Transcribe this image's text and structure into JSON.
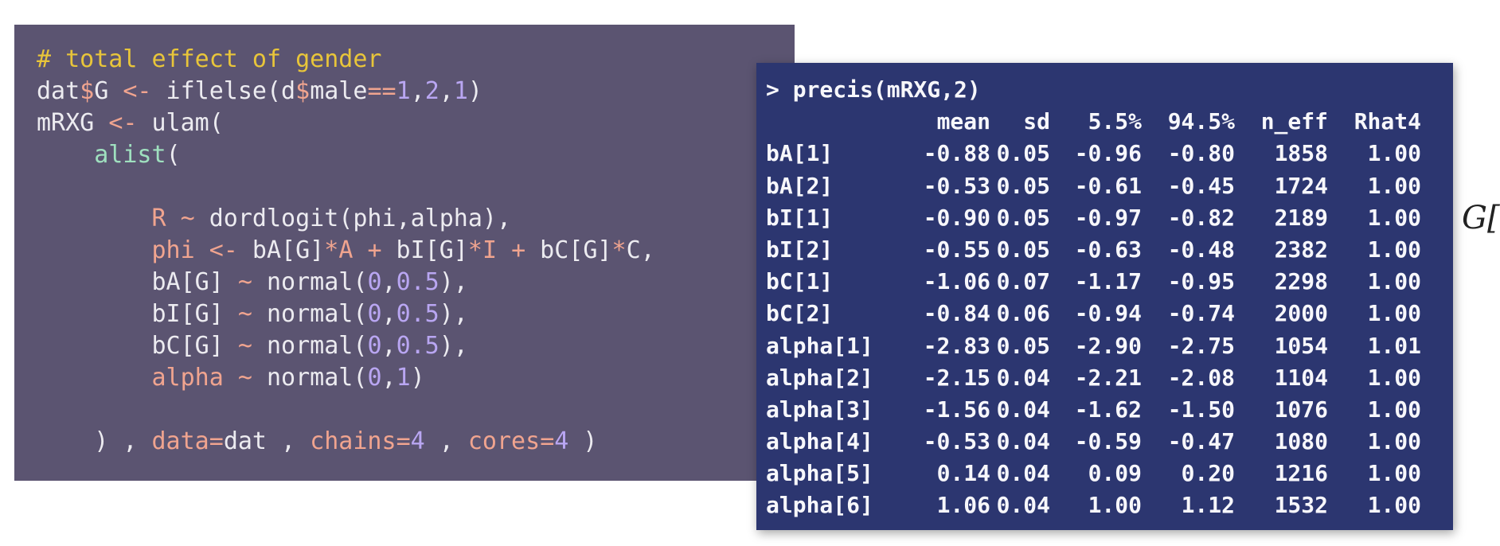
{
  "code": {
    "line1": [
      {
        "t": "# total effect of gender",
        "c": "comment"
      }
    ],
    "line2": [
      {
        "t": "dat",
        "c": "plain"
      },
      {
        "t": "$",
        "c": "op"
      },
      {
        "t": "G ",
        "c": "plain"
      },
      {
        "t": "<-",
        "c": "op"
      },
      {
        "t": " iflelse(d",
        "c": "plain"
      },
      {
        "t": "$",
        "c": "op"
      },
      {
        "t": "male",
        "c": "plain"
      },
      {
        "t": "==",
        "c": "op"
      },
      {
        "t": "1",
        "c": "num"
      },
      {
        "t": ",",
        "c": "plain"
      },
      {
        "t": "2",
        "c": "num"
      },
      {
        "t": ",",
        "c": "plain"
      },
      {
        "t": "1",
        "c": "num"
      },
      {
        "t": ")",
        "c": "plain"
      }
    ],
    "line3": [
      {
        "t": "mRXG ",
        "c": "plain"
      },
      {
        "t": "<-",
        "c": "op"
      },
      {
        "t": " ulam(",
        "c": "plain"
      }
    ],
    "line4": [
      {
        "t": "    ",
        "c": "plain"
      },
      {
        "t": "alist",
        "c": "fn"
      },
      {
        "t": "(",
        "c": "plain"
      }
    ],
    "line5": [
      {
        "t": "",
        "c": "plain"
      }
    ],
    "line6": [
      {
        "t": "        ",
        "c": "plain"
      },
      {
        "t": "R",
        "c": "param"
      },
      {
        "t": " ",
        "c": "plain"
      },
      {
        "t": "~",
        "c": "op"
      },
      {
        "t": " dordlogit(phi,alpha),",
        "c": "plain"
      }
    ],
    "line7": [
      {
        "t": "        ",
        "c": "plain"
      },
      {
        "t": "phi",
        "c": "param"
      },
      {
        "t": " ",
        "c": "plain"
      },
      {
        "t": "<-",
        "c": "op"
      },
      {
        "t": " bA[G]",
        "c": "plain"
      },
      {
        "t": "*",
        "c": "op"
      },
      {
        "t": "A",
        "c": "param"
      },
      {
        "t": " ",
        "c": "plain"
      },
      {
        "t": "+",
        "c": "op"
      },
      {
        "t": " bI[G]",
        "c": "plain"
      },
      {
        "t": "*",
        "c": "op"
      },
      {
        "t": "I",
        "c": "param"
      },
      {
        "t": " ",
        "c": "plain"
      },
      {
        "t": "+",
        "c": "op"
      },
      {
        "t": " bC[G]",
        "c": "plain"
      },
      {
        "t": "*",
        "c": "op"
      },
      {
        "t": "C,",
        "c": "plain"
      }
    ],
    "line8": [
      {
        "t": "        bA[G] ",
        "c": "plain"
      },
      {
        "t": "~",
        "c": "op"
      },
      {
        "t": " normal(",
        "c": "plain"
      },
      {
        "t": "0",
        "c": "num"
      },
      {
        "t": ",",
        "c": "plain"
      },
      {
        "t": "0.5",
        "c": "num"
      },
      {
        "t": "),",
        "c": "plain"
      }
    ],
    "line9": [
      {
        "t": "        bI[G] ",
        "c": "plain"
      },
      {
        "t": "~",
        "c": "op"
      },
      {
        "t": " normal(",
        "c": "plain"
      },
      {
        "t": "0",
        "c": "num"
      },
      {
        "t": ",",
        "c": "plain"
      },
      {
        "t": "0.5",
        "c": "num"
      },
      {
        "t": "),",
        "c": "plain"
      }
    ],
    "line10": [
      {
        "t": "        bC[G] ",
        "c": "plain"
      },
      {
        "t": "~",
        "c": "op"
      },
      {
        "t": " normal(",
        "c": "plain"
      },
      {
        "t": "0",
        "c": "num"
      },
      {
        "t": ",",
        "c": "plain"
      },
      {
        "t": "0.5",
        "c": "num"
      },
      {
        "t": "),",
        "c": "plain"
      }
    ],
    "line11": [
      {
        "t": "        ",
        "c": "plain"
      },
      {
        "t": "alpha",
        "c": "param"
      },
      {
        "t": " ",
        "c": "plain"
      },
      {
        "t": "~",
        "c": "op"
      },
      {
        "t": " normal(",
        "c": "plain"
      },
      {
        "t": "0",
        "c": "num"
      },
      {
        "t": ",",
        "c": "plain"
      },
      {
        "t": "1",
        "c": "num"
      },
      {
        "t": ")",
        "c": "plain"
      }
    ],
    "line12": [
      {
        "t": "",
        "c": "plain"
      }
    ],
    "line13": [
      {
        "t": "    ) , ",
        "c": "plain"
      },
      {
        "t": "data",
        "c": "param"
      },
      {
        "t": "=",
        "c": "op"
      },
      {
        "t": "dat , ",
        "c": "plain"
      },
      {
        "t": "chains",
        "c": "param"
      },
      {
        "t": "=",
        "c": "op"
      },
      {
        "t": "4",
        "c": "num"
      },
      {
        "t": " , ",
        "c": "plain"
      },
      {
        "t": "cores",
        "c": "param"
      },
      {
        "t": "=",
        "c": "op"
      },
      {
        "t": "4",
        "c": "num"
      },
      {
        "t": " )",
        "c": "plain"
      }
    ]
  },
  "output": {
    "command": "> precis(mRXG,2)",
    "headers": [
      "",
      "mean",
      "sd",
      "5.5%",
      "94.5%",
      "n_eff",
      "Rhat4"
    ],
    "rows": [
      [
        "bA[1]",
        "-0.88",
        "0.05",
        "-0.96",
        "-0.80",
        "1858",
        "1.00"
      ],
      [
        "bA[2]",
        "-0.53",
        "0.05",
        "-0.61",
        "-0.45",
        "1724",
        "1.00"
      ],
      [
        "bI[1]",
        "-0.90",
        "0.05",
        "-0.97",
        "-0.82",
        "2189",
        "1.00"
      ],
      [
        "bI[2]",
        "-0.55",
        "0.05",
        "-0.63",
        "-0.48",
        "2382",
        "1.00"
      ],
      [
        "bC[1]",
        "-1.06",
        "0.07",
        "-1.17",
        "-0.95",
        "2298",
        "1.00"
      ],
      [
        "bC[2]",
        "-0.84",
        "0.06",
        "-0.94",
        "-0.74",
        "2000",
        "1.00"
      ],
      [
        "alpha[1]",
        "-2.83",
        "0.05",
        "-2.90",
        "-2.75",
        "1054",
        "1.01"
      ],
      [
        "alpha[2]",
        "-2.15",
        "0.04",
        "-2.21",
        "-2.08",
        "1104",
        "1.00"
      ],
      [
        "alpha[3]",
        "-1.56",
        "0.04",
        "-1.62",
        "-1.50",
        "1076",
        "1.00"
      ],
      [
        "alpha[4]",
        "-0.53",
        "0.04",
        "-0.59",
        "-0.47",
        "1080",
        "1.00"
      ],
      [
        "alpha[5]",
        "0.14",
        "0.04",
        "0.09",
        "0.20",
        "1216",
        "1.00"
      ],
      [
        "alpha[6]",
        "1.06",
        "0.04",
        "1.00",
        "1.12",
        "1532",
        "1.00"
      ]
    ]
  },
  "side_text": "G[i],",
  "colors": {
    "code_bg": "#5b5471",
    "output_bg": "#2c3670",
    "comment": "#e8c53a",
    "operator": "#f0a48f",
    "number": "#b9a6f2",
    "function": "#9fe0bf"
  }
}
